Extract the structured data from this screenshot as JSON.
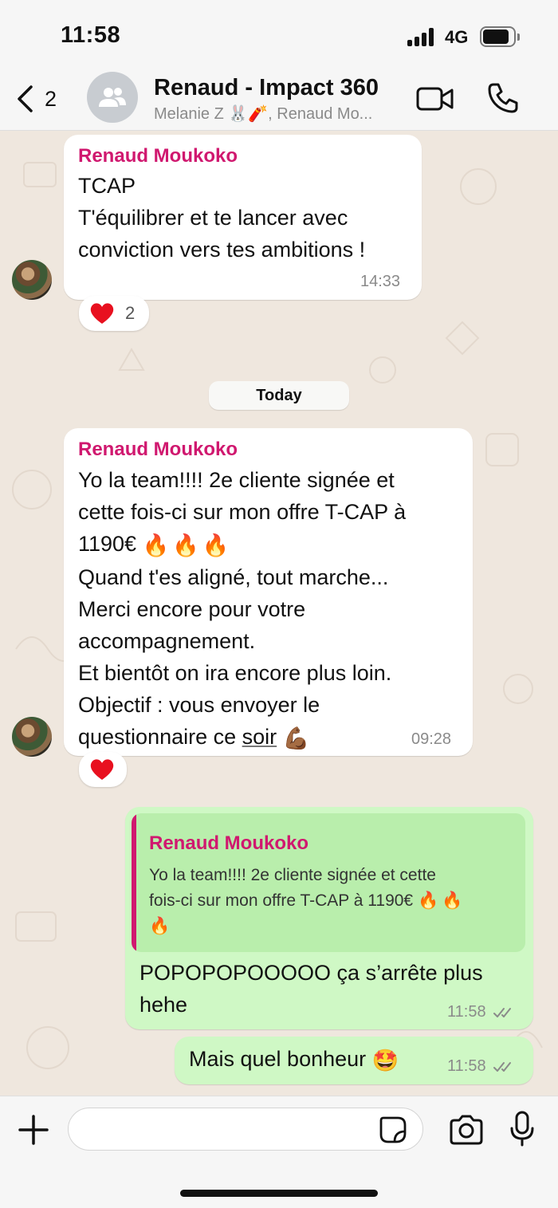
{
  "status_bar": {
    "time": "11:58",
    "network": "4G"
  },
  "header": {
    "back_count": "2",
    "title": "Renaud - Impact 360",
    "subtitle": "Melanie Z 🐰🧨, Renaud Mo..."
  },
  "messages": [
    {
      "sender": "Renaud Moukoko",
      "text": "TCAP\nT'équilibrer et te lancer avec\nconviction vers tes ambitions !",
      "time": "14:33",
      "reaction": "❤️",
      "reaction_count": "2"
    },
    {
      "sender": "Renaud Moukoko",
      "line1": "Yo la team!!!! 2e cliente signée et",
      "line2": "cette fois-ci sur mon offre T-CAP à",
      "line3": "1190€",
      "line3_emoji": "🔥🔥🔥",
      "line4": "Quand t'es aligné, tout marche...",
      "line5": "Merci encore pour votre",
      "line6": "accompagnement.",
      "line7": "Et bientôt on ira encore plus loin.",
      "line8": "Objectif : vous envoyer le",
      "line9a": "questionnaire ce ",
      "line9b": "soir",
      "line9_emoji": "💪🏾",
      "time": "09:28",
      "reaction": "❤️"
    },
    {
      "quote_sender": "Renaud Moukoko",
      "quote_line1": "Yo la team!!!! 2e cliente signée et cette",
      "quote_line2": "fois-ci sur mon offre T-CAP à 1190€",
      "quote_emoji": "🔥🔥",
      "quote_line3_emoji": "🔥",
      "text": "POPOPOPOOOOO ça s’arrête plus\nhehe",
      "time": "11:58"
    },
    {
      "text": "Mais quel bonheur",
      "emoji": "🤩",
      "time": "11:58"
    }
  ],
  "date_separator": "Today",
  "input": {
    "placeholder": ""
  },
  "colors": {
    "sender_name": "#d0186f",
    "outgoing_bubble": "#cff8c5",
    "incoming_bubble": "#ffffff",
    "wallpaper": "#efe7de"
  },
  "icons": [
    "back-chevron-icon",
    "group-avatar-icon",
    "video-call-icon",
    "phone-icon",
    "heart-icon",
    "double-check-icon",
    "plus-icon",
    "sticker-icon",
    "camera-icon",
    "mic-icon"
  ]
}
